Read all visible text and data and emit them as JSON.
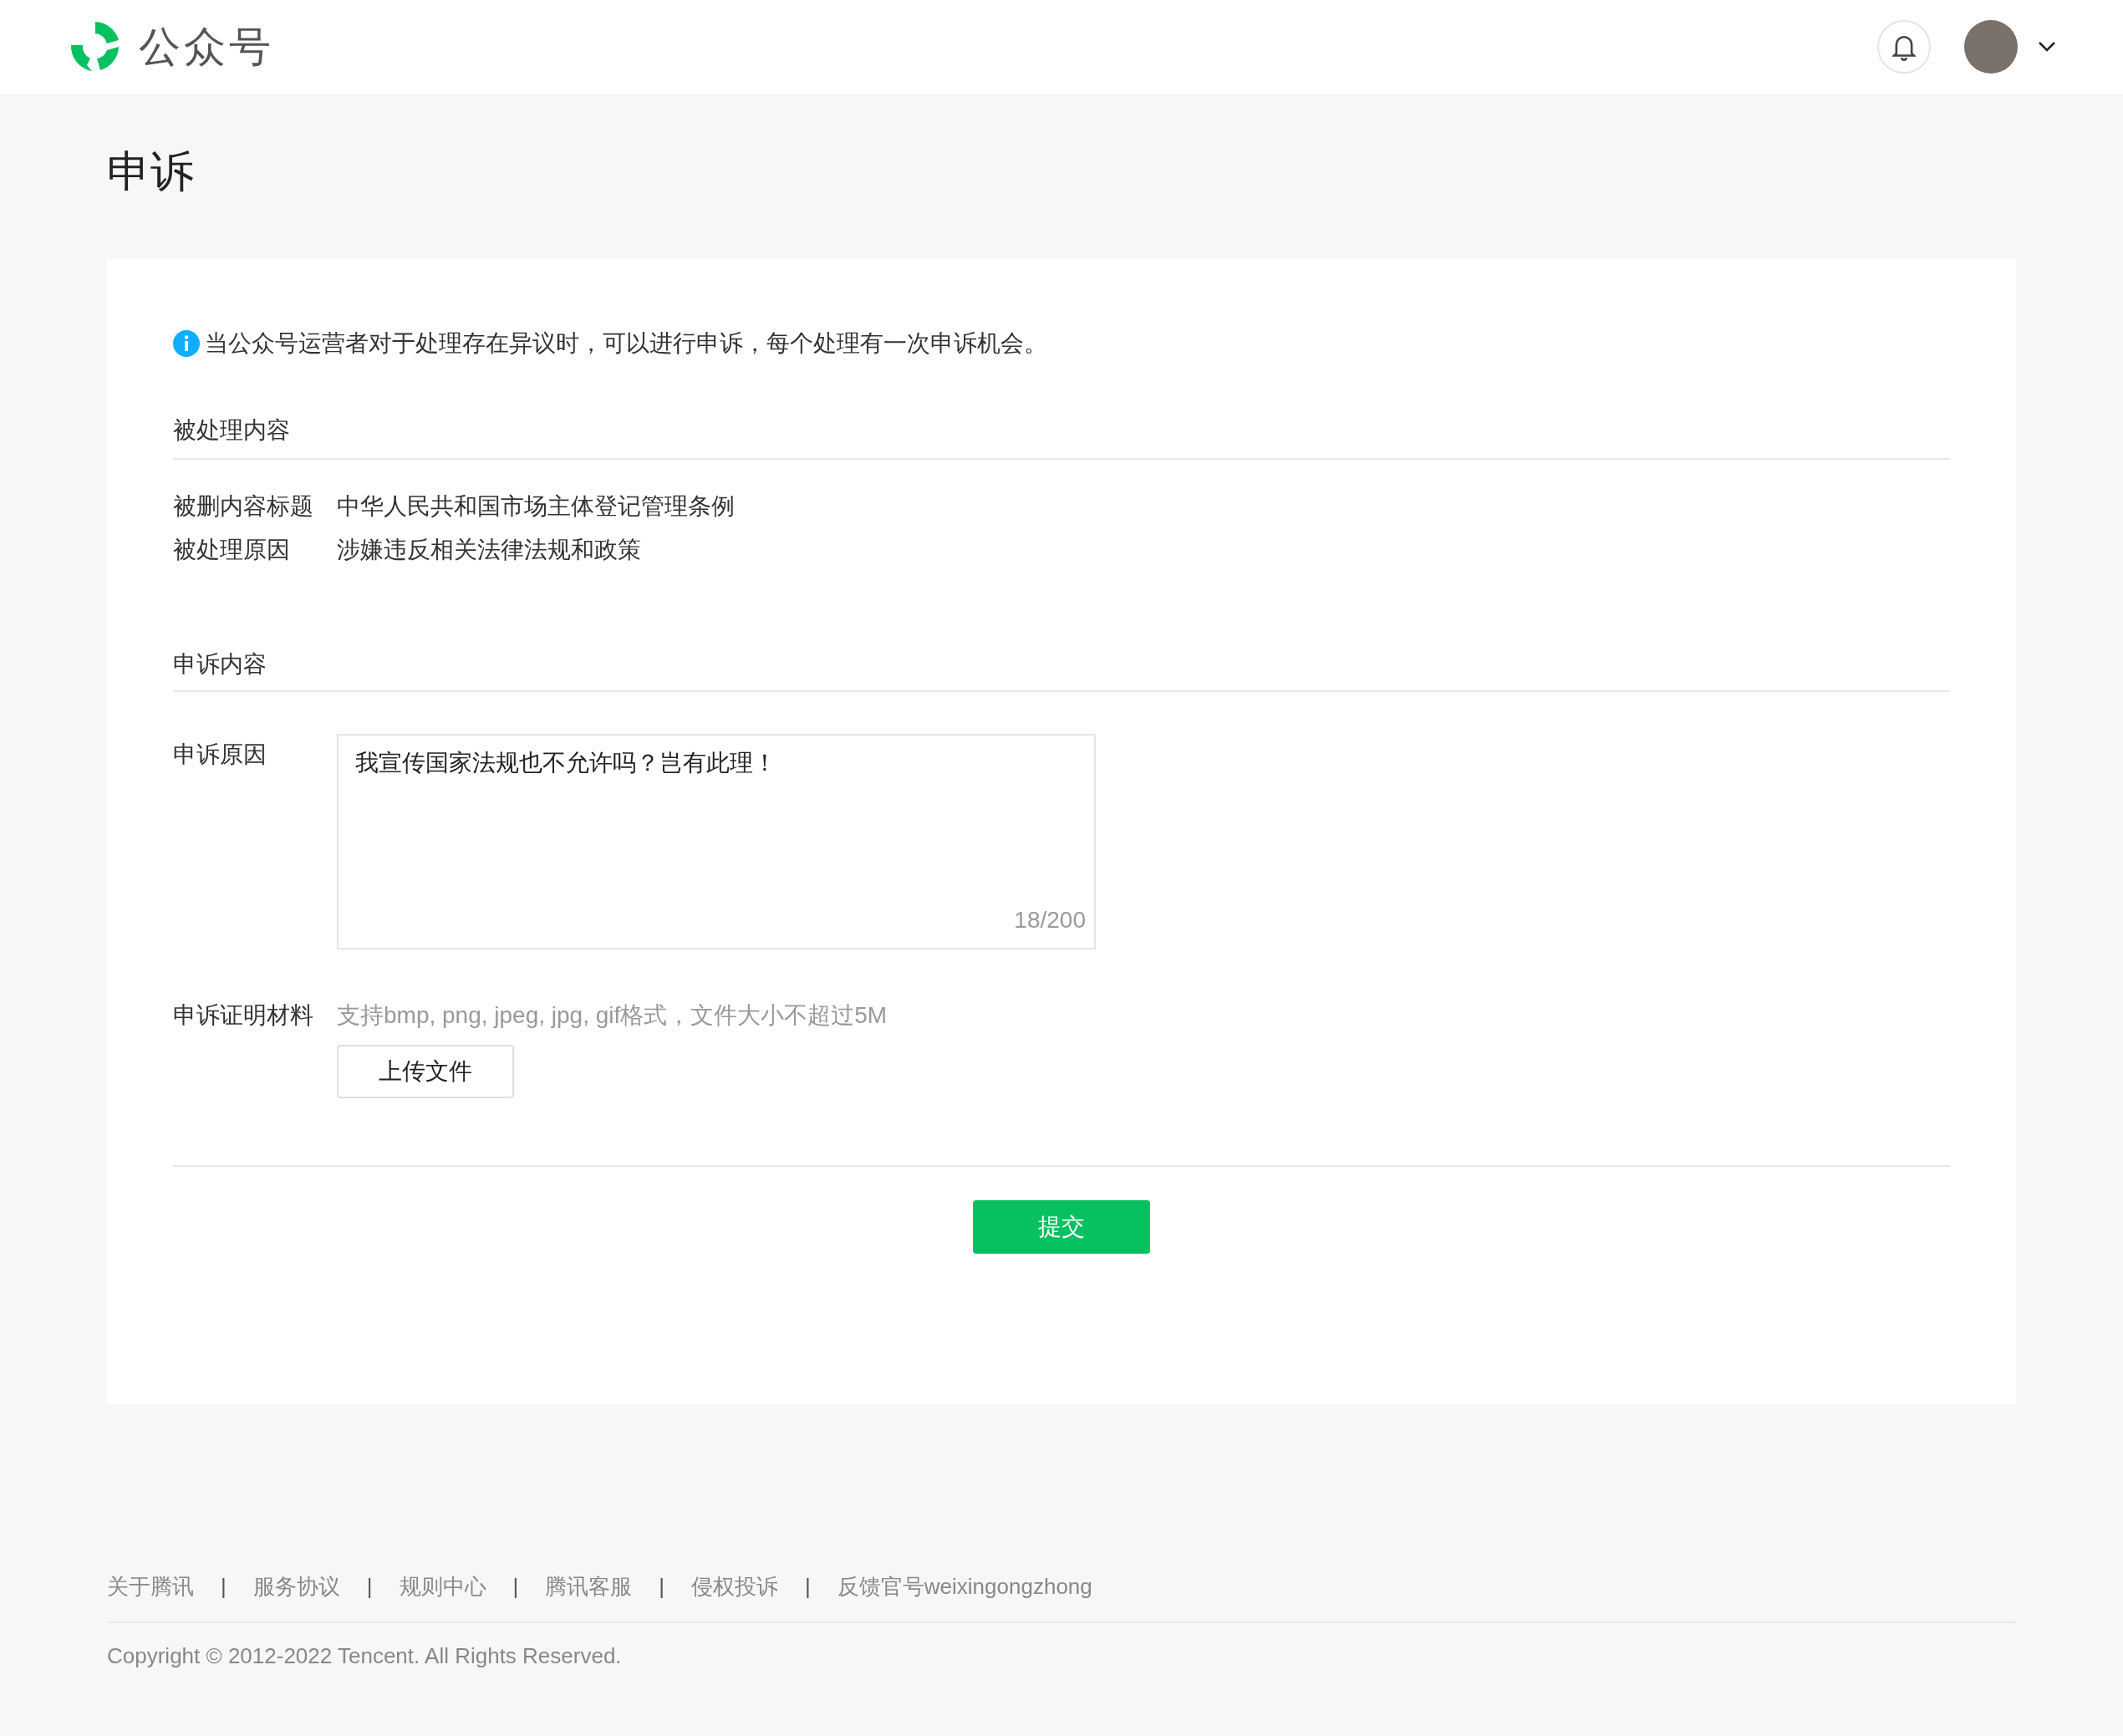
{
  "header": {
    "brand": "公众号"
  },
  "page": {
    "title": "申诉"
  },
  "notice": "当公众号运营者对于处理存在异议时，可以进行申诉，每个处理有一次申诉机会。",
  "handled_section": {
    "title": "被处理内容",
    "rows": [
      {
        "label": "被删内容标题",
        "value": "中华人民共和国市场主体登记管理条例"
      },
      {
        "label": "被处理原因",
        "value": "涉嫌违反相关法律法规和政策"
      }
    ]
  },
  "appeal_section": {
    "title": "申诉内容",
    "reason": {
      "label": "申诉原因",
      "value": "我宣传国家法规也不允许吗？岂有此理！",
      "counter": "18/200"
    },
    "evidence": {
      "label": "申诉证明材料",
      "hint": "支持bmp, png, jpeg, jpg, gif格式，文件大小不超过5M",
      "button": "上传文件"
    }
  },
  "submit_button": "提交",
  "footer": {
    "items": [
      {
        "kind": "link",
        "text": "关于腾讯"
      },
      {
        "kind": "separator",
        "text": "|"
      },
      {
        "kind": "link",
        "text": "服务协议"
      },
      {
        "kind": "separator",
        "text": "|"
      },
      {
        "kind": "link",
        "text": "规则中心"
      },
      {
        "kind": "separator",
        "text": "|"
      },
      {
        "kind": "link",
        "text": "腾讯客服"
      },
      {
        "kind": "separator",
        "text": "|"
      },
      {
        "kind": "link",
        "text": "侵权投诉"
      },
      {
        "kind": "separator",
        "text": "|"
      },
      {
        "kind": "link",
        "text": "反馈官号weixingongzhong"
      }
    ],
    "copyright": "Copyright © 2012-2022 Tencent. All Rights Reserved."
  }
}
